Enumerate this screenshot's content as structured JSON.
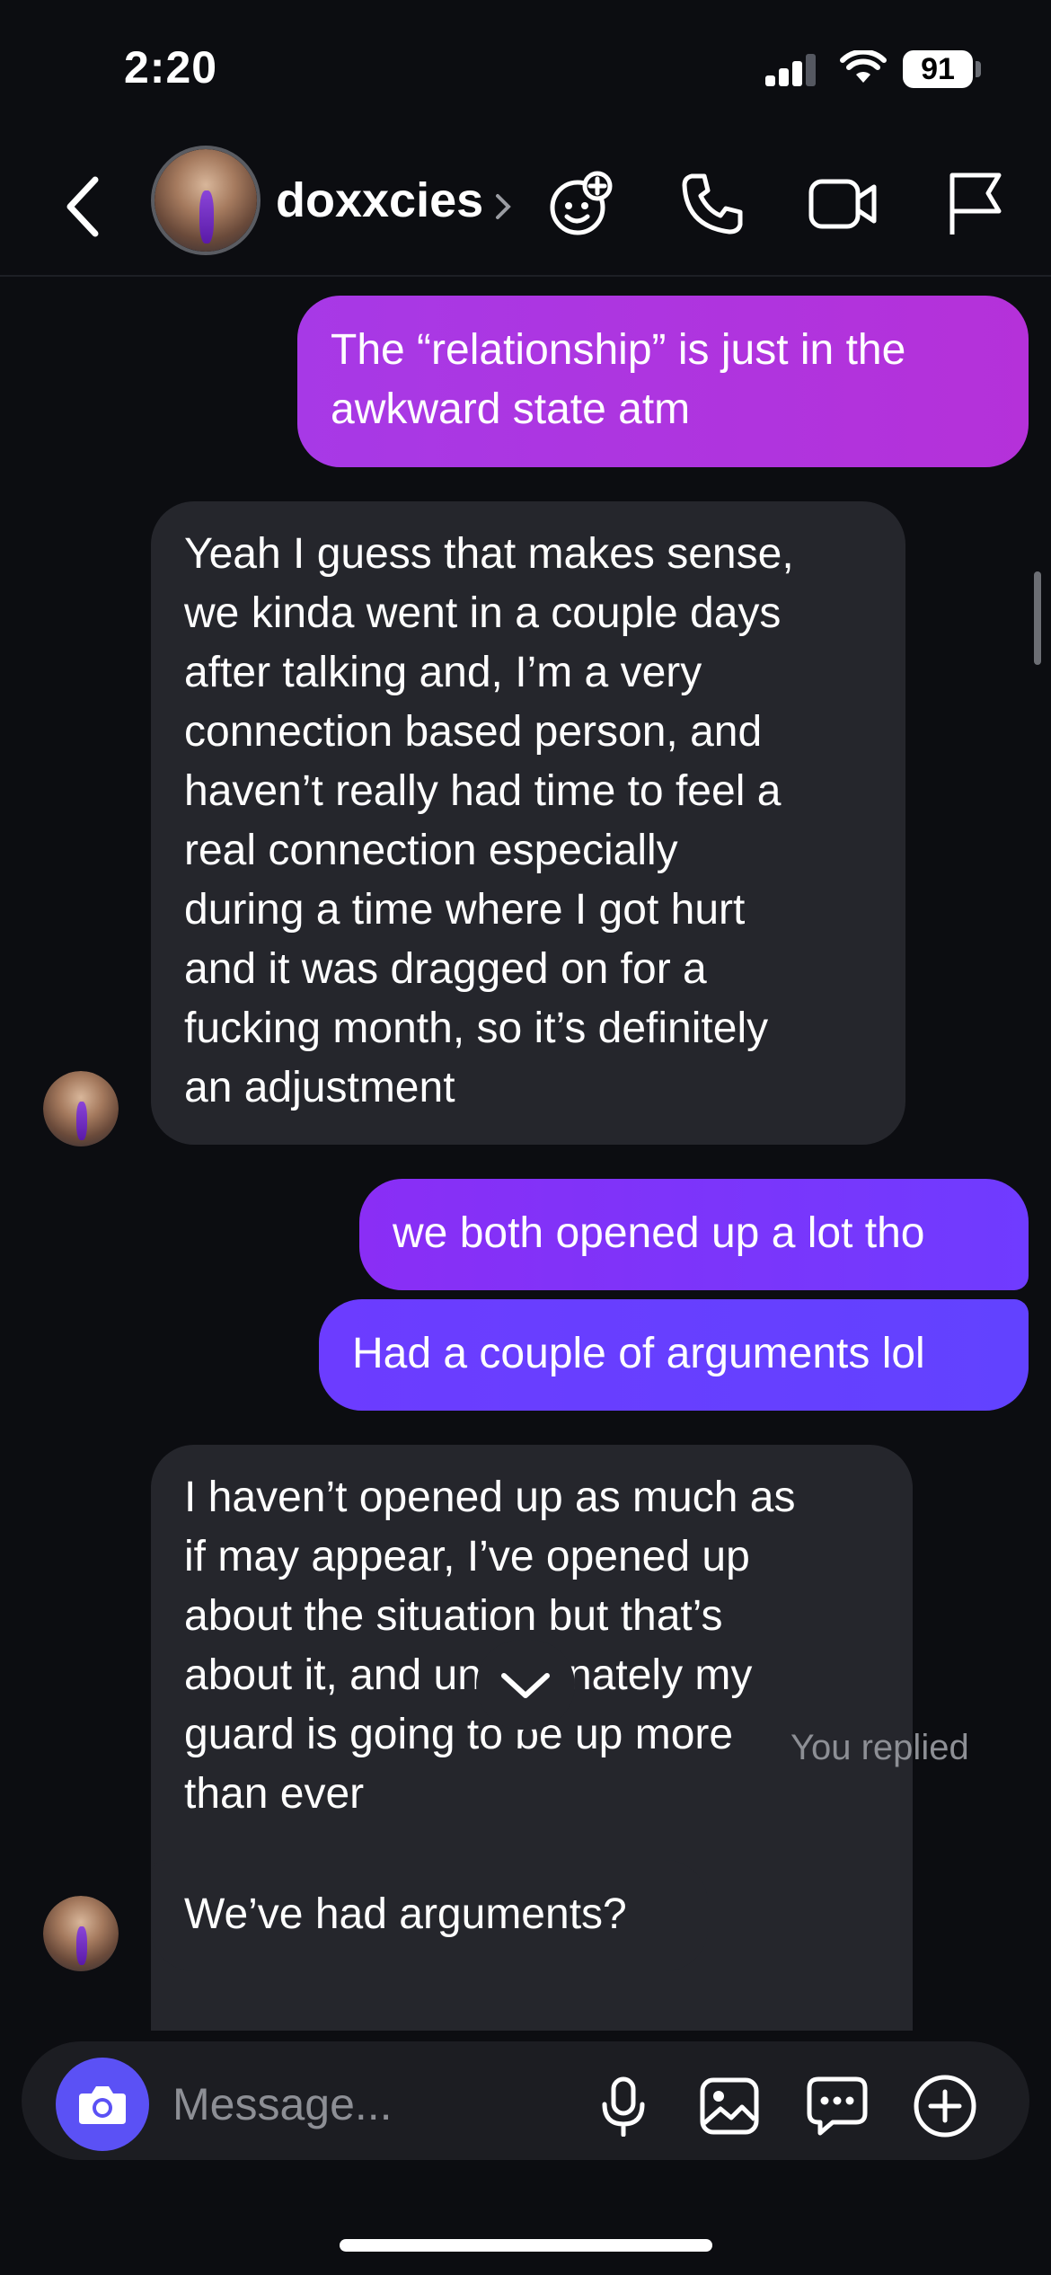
{
  "status_bar": {
    "time": "2:20",
    "battery": "91"
  },
  "header": {
    "username": "doxxcies"
  },
  "messages": [
    {
      "from": "me",
      "text": "The “relationship” is just in the\nawkward state atm"
    },
    {
      "from": "them",
      "text": "Yeah I guess that makes sense,\nwe kinda went in a couple days\nafter talking and, I’m a very\nconnection based person, and\nhaven’t really had time to feel a\nreal connection especially\nduring a time where I got hurt\nand it was dragged on for a\nfucking month, so it’s definitely\nan adjustment"
    },
    {
      "from": "me",
      "text": "we both opened up a lot tho"
    },
    {
      "from": "me",
      "text": "Had a couple of arguments lol"
    },
    {
      "from": "them",
      "text": "I haven’t opened up as much as\nif may appear, I’ve opened up\nabout the situation but that’s\nabout it, and unfortunately my\nguard is going to be up more\nthan ever"
    },
    {
      "from": "them",
      "text": "We’ve had arguments?"
    }
  ],
  "thread_note": "You replied",
  "composer": {
    "placeholder": "Message..."
  },
  "colors": {
    "sent_bubble": "#7b2dff",
    "received_bubble": "#25262c",
    "camera_button": "#5b51f5",
    "background": "#0c0d11"
  },
  "icons": [
    "back-icon",
    "chevron-right-icon",
    "effects-icon",
    "phone-icon",
    "video-icon",
    "flag-icon",
    "chevron-down-icon",
    "camera-icon",
    "microphone-icon",
    "image-icon",
    "sticker-icon",
    "plus-icon"
  ]
}
